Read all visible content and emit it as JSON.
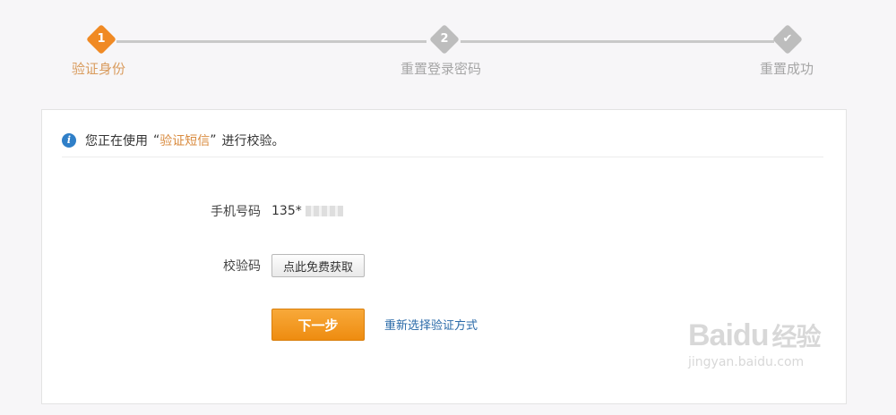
{
  "steps": [
    {
      "number": "1",
      "label": "验证身份",
      "state": "active"
    },
    {
      "number": "2",
      "label": "重置登录密码",
      "state": "pending"
    },
    {
      "number": "✔",
      "label": "重置成功",
      "state": "pending"
    }
  ],
  "notice": {
    "prefix": "您正在使用",
    "open_quote": "“",
    "method": "验证短信",
    "close_quote": "”",
    "suffix": "进行校验。"
  },
  "form": {
    "phone_label": "手机号码",
    "phone_value": "135*",
    "code_label": "校验码",
    "get_code_button": "点此免费获取"
  },
  "actions": {
    "next_button": "下一步",
    "reselect_link": "重新选择验证方式"
  },
  "watermark": {
    "logo": "Bai",
    "logo_tail": "du",
    "logo_cn": "经验",
    "url": "jingyan.baidu.com"
  },
  "colors": {
    "active_step": "#f08a24",
    "inactive_step": "#bdbdbd",
    "link": "#2a6aa8",
    "primary_button": "#ee8c10"
  },
  "icons": {
    "info": "info-icon",
    "step_done": "check-icon"
  }
}
